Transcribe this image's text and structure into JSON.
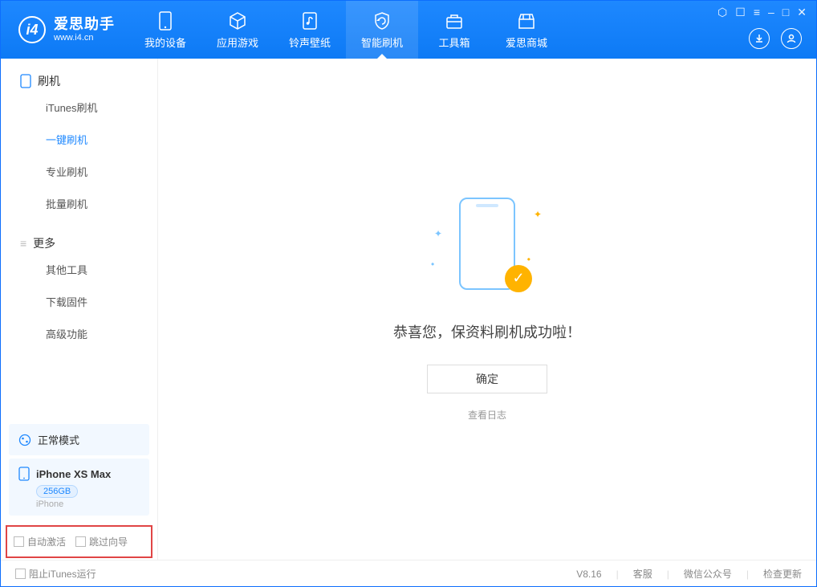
{
  "app": {
    "title": "爱思助手",
    "subtitle": "www.i4.cn"
  },
  "tabs": {
    "device": "我的设备",
    "apps": "应用游戏",
    "ringtones": "铃声壁纸",
    "flash": "智能刷机",
    "toolbox": "工具箱",
    "store": "爱思商城"
  },
  "sidebar": {
    "group_flash": "刷机",
    "items_flash": {
      "itunes": "iTunes刷机",
      "oneclick": "一键刷机",
      "pro": "专业刷机",
      "batch": "批量刷机"
    },
    "group_more": "更多",
    "items_more": {
      "other": "其他工具",
      "firmware": "下载固件",
      "advanced": "高级功能"
    }
  },
  "status": {
    "mode": "正常模式"
  },
  "device": {
    "name": "iPhone XS Max",
    "capacity": "256GB",
    "type": "iPhone"
  },
  "options": {
    "auto_activate": "自动激活",
    "skip_guide": "跳过向导"
  },
  "main": {
    "success": "恭喜您，保资料刷机成功啦！",
    "ok": "确定",
    "view_log": "查看日志"
  },
  "footer": {
    "block_itunes": "阻止iTunes运行",
    "version": "V8.16",
    "support": "客服",
    "wechat": "微信公众号",
    "update": "检查更新"
  }
}
